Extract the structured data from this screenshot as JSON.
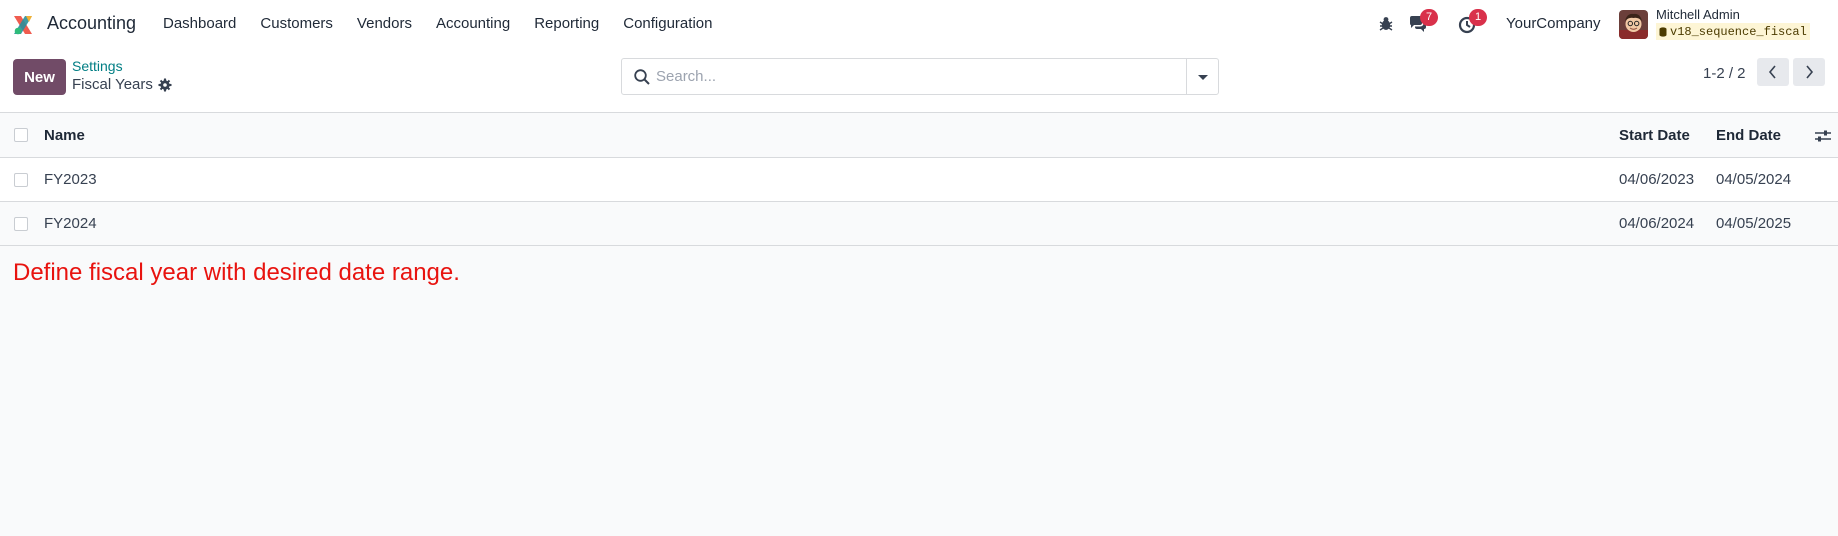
{
  "navbar": {
    "app_name": "Accounting",
    "menu": [
      "Dashboard",
      "Customers",
      "Vendors",
      "Accounting",
      "Reporting",
      "Configuration"
    ],
    "messages_count": "7",
    "activities_count": "1",
    "company": "YourCompany",
    "user_name": "Mitchell Admin",
    "db_name": "v18_sequence_fiscal"
  },
  "control_panel": {
    "new_label": "New",
    "breadcrumb_parent": "Settings",
    "breadcrumb_current": "Fiscal Years",
    "search_placeholder": "Search...",
    "pager_text": "1-2 / 2"
  },
  "list": {
    "columns": [
      "Name",
      "Start Date",
      "End Date"
    ],
    "rows": [
      {
        "name": "FY2023",
        "start": "04/06/2023",
        "end": "04/05/2024"
      },
      {
        "name": "FY2024",
        "start": "04/06/2024",
        "end": "04/05/2025"
      }
    ]
  },
  "note": "Define fiscal year with desired date range.",
  "colors": {
    "brand": "#714b67",
    "link": "#017e84",
    "badge": "#d9314b",
    "note": "#e8130f"
  }
}
